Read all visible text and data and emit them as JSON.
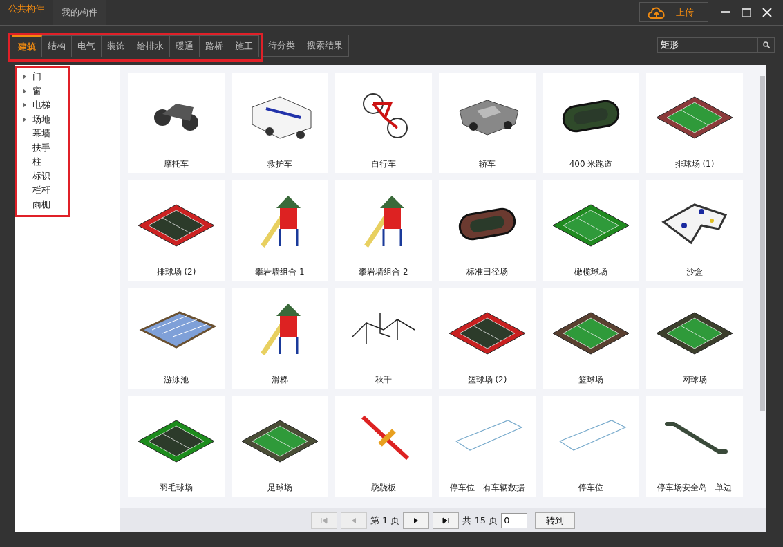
{
  "top_tabs": [
    {
      "label": "公共构件",
      "selected": true
    },
    {
      "label": "我的构件",
      "selected": false
    }
  ],
  "upload_button": "上传",
  "category_tabs": {
    "framed": [
      {
        "label": "建筑",
        "selected": true
      },
      {
        "label": "结构",
        "selected": false
      },
      {
        "label": "电气",
        "selected": false
      },
      {
        "label": "装饰",
        "selected": false
      },
      {
        "label": "给排水",
        "selected": false
      },
      {
        "label": "暖通",
        "selected": false
      },
      {
        "label": "路桥",
        "selected": false
      },
      {
        "label": "施工",
        "selected": false
      }
    ],
    "unframed": [
      {
        "label": "待分类",
        "selected": false
      },
      {
        "label": "搜索结果",
        "selected": false
      }
    ]
  },
  "search": {
    "value": "矩形"
  },
  "tree": [
    {
      "label": "门",
      "expandable": true
    },
    {
      "label": "窗",
      "expandable": true
    },
    {
      "label": "电梯",
      "expandable": true
    },
    {
      "label": "场地",
      "expandable": true
    },
    {
      "label": "幕墙",
      "expandable": false
    },
    {
      "label": "扶手",
      "expandable": false
    },
    {
      "label": "柱",
      "expandable": false
    },
    {
      "label": "标识",
      "expandable": false
    },
    {
      "label": "栏杆",
      "expandable": false
    },
    {
      "label": "雨棚",
      "expandable": false
    }
  ],
  "components": [
    {
      "name": "摩托车",
      "kind": "motorcycle"
    },
    {
      "name": "救护车",
      "kind": "van"
    },
    {
      "name": "自行车",
      "kind": "bicycle"
    },
    {
      "name": "轿车",
      "kind": "car"
    },
    {
      "name": "400 米跑道",
      "kind": "track",
      "color": "#2f4a2a"
    },
    {
      "name": "排球场 (1)",
      "kind": "court",
      "color": "#8b3a3a"
    },
    {
      "name": "排球场 (2)",
      "kind": "court",
      "color": "#cc2222"
    },
    {
      "name": "攀岩墙组合 1",
      "kind": "playground"
    },
    {
      "name": "攀岩墙组合 2",
      "kind": "playground"
    },
    {
      "name": "标准田径场",
      "kind": "track",
      "color": "#6b3a30"
    },
    {
      "name": "橄榄球场",
      "kind": "court",
      "color": "#1f8a1f"
    },
    {
      "name": "沙盒",
      "kind": "sandbox"
    },
    {
      "name": "游泳池",
      "kind": "pool"
    },
    {
      "name": "滑梯",
      "kind": "playground"
    },
    {
      "name": "秋千",
      "kind": "swing"
    },
    {
      "name": "篮球场 (2)",
      "kind": "court",
      "color": "#c82020"
    },
    {
      "name": "篮球场",
      "kind": "court",
      "color": "#5a4030"
    },
    {
      "name": "网球场",
      "kind": "court",
      "color": "#3c3f2c"
    },
    {
      "name": "羽毛球场",
      "kind": "court",
      "color": "#1c8c1c"
    },
    {
      "name": "足球场",
      "kind": "court",
      "color": "#4a4d36"
    },
    {
      "name": "跷跷板",
      "kind": "seesaw"
    },
    {
      "name": "停车位 - 有车辆数据",
      "kind": "slab"
    },
    {
      "name": "停车位",
      "kind": "slab"
    },
    {
      "name": "停车场安全岛 - 单边",
      "kind": "island"
    }
  ],
  "pager": {
    "nav_before": [
      {
        "kind": "first",
        "disabled": true
      },
      {
        "kind": "prev",
        "disabled": true
      }
    ],
    "page_label": "第 1 页",
    "nav_after": [
      {
        "kind": "next",
        "disabled": false
      },
      {
        "kind": "last",
        "disabled": false
      }
    ],
    "total_label": "共 15 页",
    "page_input": "0",
    "go_button": "转到"
  }
}
